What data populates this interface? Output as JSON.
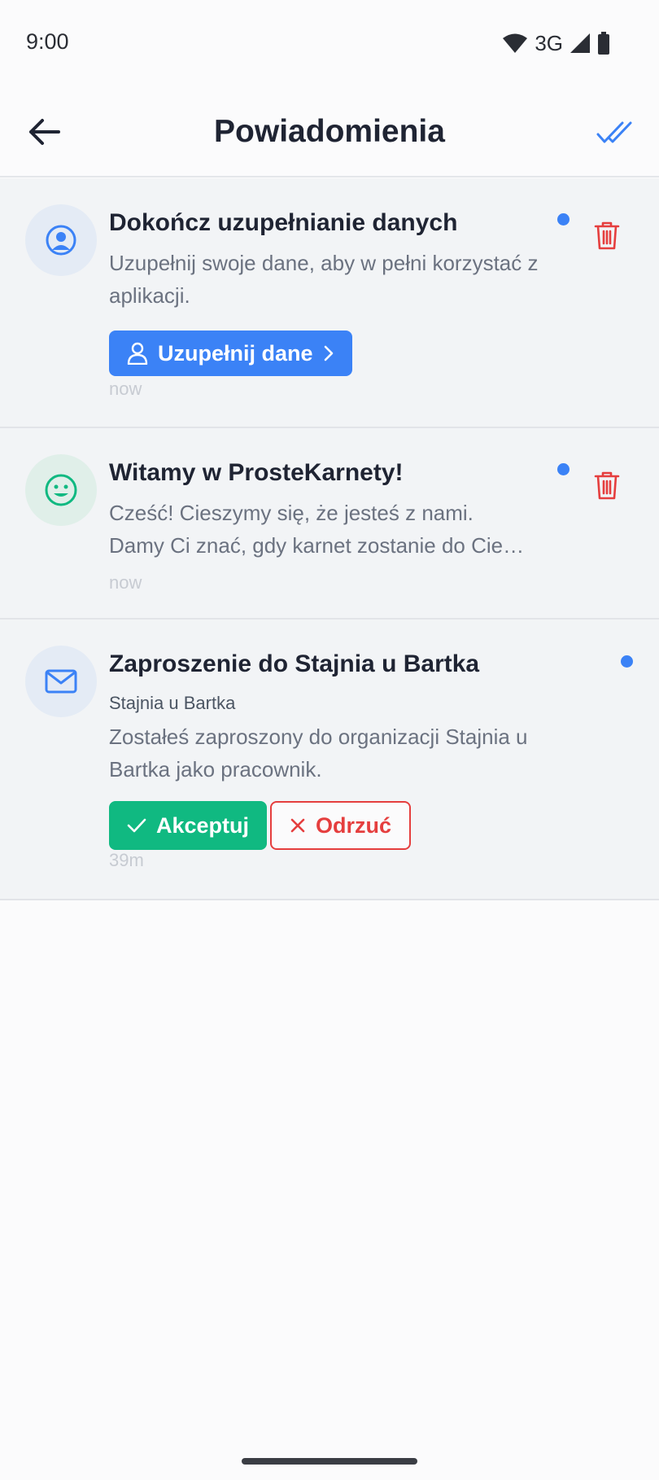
{
  "status_bar": {
    "time": "9:00",
    "network": "3G",
    "icons": [
      "wifi-icon",
      "signal-icon",
      "battery-icon"
    ]
  },
  "header": {
    "title": "Powiadomienia",
    "back_icon": "arrow-left-icon",
    "mark_all_icon": "double-check-icon"
  },
  "notifications": [
    {
      "icon": "user-circle-icon",
      "title": "Dokończ uzupełnianie danych",
      "body": "Uzupełnij swoje dane, aby w pełni korzystać z aplikacji.",
      "action_label": "Uzupełnij dane",
      "time": "now",
      "unread": true
    },
    {
      "icon": "smile-icon",
      "title": "Witamy w ProsteKarnety!",
      "body_line1": "Cześć! Cieszymy się, że jesteś z nami.",
      "body_line2": "Damy Ci znać, gdy karnet zostanie do Cie…",
      "time": "now",
      "unread": true
    },
    {
      "icon": "mail-icon",
      "title": "Zaproszenie do Stajnia u Bartka",
      "subtitle": "Stajnia u Bartka",
      "body": "Zostałeś zaproszony do organizacji Stajnia u Bartka jako pracownik.",
      "accept_label": "Akceptuj",
      "reject_label": "Odrzuć",
      "time": "39m",
      "unread": true
    }
  ],
  "colors": {
    "accent": "#3b82f6",
    "success": "#10b981",
    "danger": "#e53e3e",
    "card_bg": "#f2f4f6"
  }
}
